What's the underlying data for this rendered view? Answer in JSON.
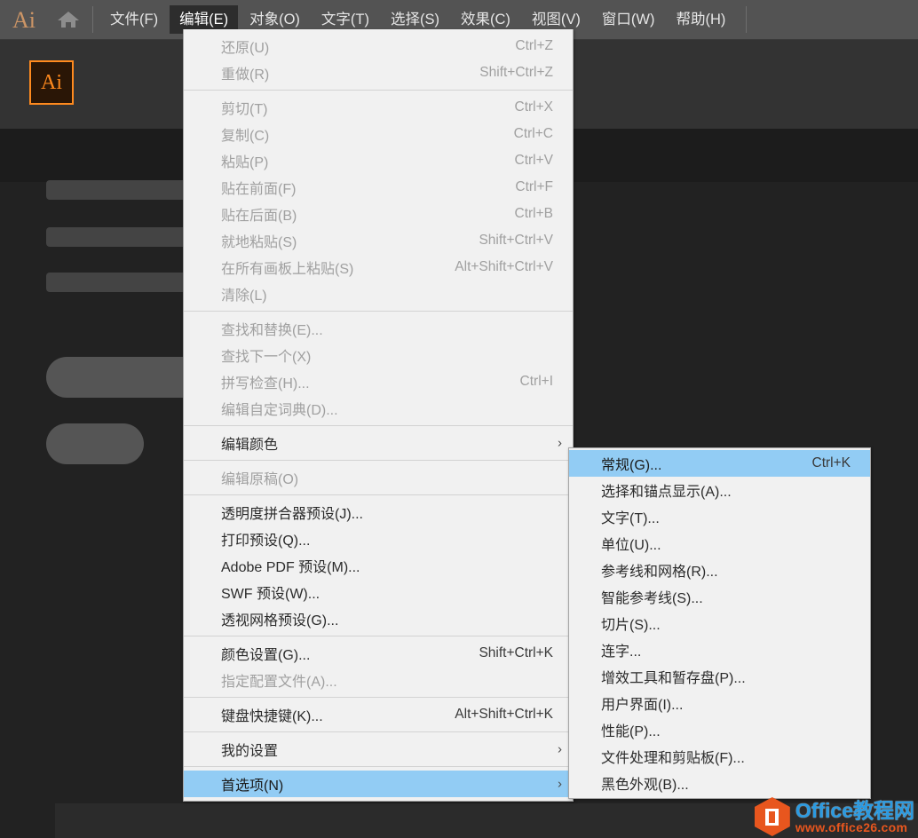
{
  "app": {
    "logo": "Ai",
    "home_icon": "home-icon",
    "document_badge": "Ai"
  },
  "menubar": {
    "items": [
      {
        "label": "文件(F)",
        "active": false
      },
      {
        "label": "编辑(E)",
        "active": true
      },
      {
        "label": "对象(O)",
        "active": false
      },
      {
        "label": "文字(T)",
        "active": false
      },
      {
        "label": "选择(S)",
        "active": false
      },
      {
        "label": "效果(C)",
        "active": false
      },
      {
        "label": "视图(V)",
        "active": false
      },
      {
        "label": "窗口(W)",
        "active": false
      },
      {
        "label": "帮助(H)",
        "active": false
      }
    ]
  },
  "edit_menu": {
    "groups": [
      [
        {
          "label": "还原(U)",
          "accel": "Ctrl+Z",
          "disabled": true
        },
        {
          "label": "重做(R)",
          "accel": "Shift+Ctrl+Z",
          "disabled": true
        }
      ],
      [
        {
          "label": "剪切(T)",
          "accel": "Ctrl+X",
          "disabled": true
        },
        {
          "label": "复制(C)",
          "accel": "Ctrl+C",
          "disabled": true
        },
        {
          "label": "粘贴(P)",
          "accel": "Ctrl+V",
          "disabled": true
        },
        {
          "label": "贴在前面(F)",
          "accel": "Ctrl+F",
          "disabled": true
        },
        {
          "label": "贴在后面(B)",
          "accel": "Ctrl+B",
          "disabled": true
        },
        {
          "label": "就地粘贴(S)",
          "accel": "Shift+Ctrl+V",
          "disabled": true
        },
        {
          "label": "在所有画板上粘贴(S)",
          "accel": "Alt+Shift+Ctrl+V",
          "disabled": true
        },
        {
          "label": "清除(L)",
          "accel": "",
          "disabled": true
        }
      ],
      [
        {
          "label": "查找和替换(E)...",
          "accel": "",
          "disabled": true
        },
        {
          "label": "查找下一个(X)",
          "accel": "",
          "disabled": true
        },
        {
          "label": "拼写检查(H)...",
          "accel": "Ctrl+I",
          "disabled": true
        },
        {
          "label": "编辑自定词典(D)...",
          "accel": "",
          "disabled": true
        }
      ],
      [
        {
          "label": "编辑颜色",
          "accel": "",
          "disabled": false,
          "submenu": true
        }
      ],
      [
        {
          "label": "编辑原稿(O)",
          "accel": "",
          "disabled": true
        }
      ],
      [
        {
          "label": "透明度拼合器预设(J)...",
          "accel": "",
          "disabled": false
        },
        {
          "label": "打印预设(Q)...",
          "accel": "",
          "disabled": false
        },
        {
          "label": "Adobe PDF 预设(M)...",
          "accel": "",
          "disabled": false
        },
        {
          "label": "SWF 预设(W)...",
          "accel": "",
          "disabled": false
        },
        {
          "label": "透视网格预设(G)...",
          "accel": "",
          "disabled": false
        }
      ],
      [
        {
          "label": "颜色设置(G)...",
          "accel": "Shift+Ctrl+K",
          "disabled": false
        },
        {
          "label": "指定配置文件(A)...",
          "accel": "",
          "disabled": true
        }
      ],
      [
        {
          "label": "键盘快捷键(K)...",
          "accel": "Alt+Shift+Ctrl+K",
          "disabled": false
        }
      ],
      [
        {
          "label": "我的设置",
          "accel": "",
          "disabled": false,
          "submenu": true
        }
      ],
      [
        {
          "label": "首选项(N)",
          "accel": "",
          "disabled": false,
          "submenu": true,
          "selected": true
        }
      ]
    ]
  },
  "preferences_submenu": {
    "items": [
      {
        "label": "常规(G)...",
        "accel": "Ctrl+K",
        "selected": true
      },
      {
        "label": "选择和锚点显示(A)...",
        "accel": ""
      },
      {
        "label": "文字(T)...",
        "accel": ""
      },
      {
        "label": "单位(U)...",
        "accel": ""
      },
      {
        "label": "参考线和网格(R)...",
        "accel": ""
      },
      {
        "label": "智能参考线(S)...",
        "accel": ""
      },
      {
        "label": "切片(S)...",
        "accel": ""
      },
      {
        "label": "连字...",
        "accel": ""
      },
      {
        "label": "增效工具和暂存盘(P)...",
        "accel": ""
      },
      {
        "label": "用户界面(I)...",
        "accel": ""
      },
      {
        "label": "性能(P)...",
        "accel": ""
      },
      {
        "label": "文件处理和剪贴板(F)...",
        "accel": ""
      },
      {
        "label": "黑色外观(B)...",
        "accel": ""
      }
    ]
  },
  "watermark": {
    "title": "Office教程网",
    "url": "www.office26.com"
  },
  "colors": {
    "menubar_bg": "#535353",
    "menu_bg": "#f1f1f1",
    "highlight": "#92ccf4",
    "accent_orange": "#ff8a1e",
    "canvas_bg": "#333333"
  }
}
